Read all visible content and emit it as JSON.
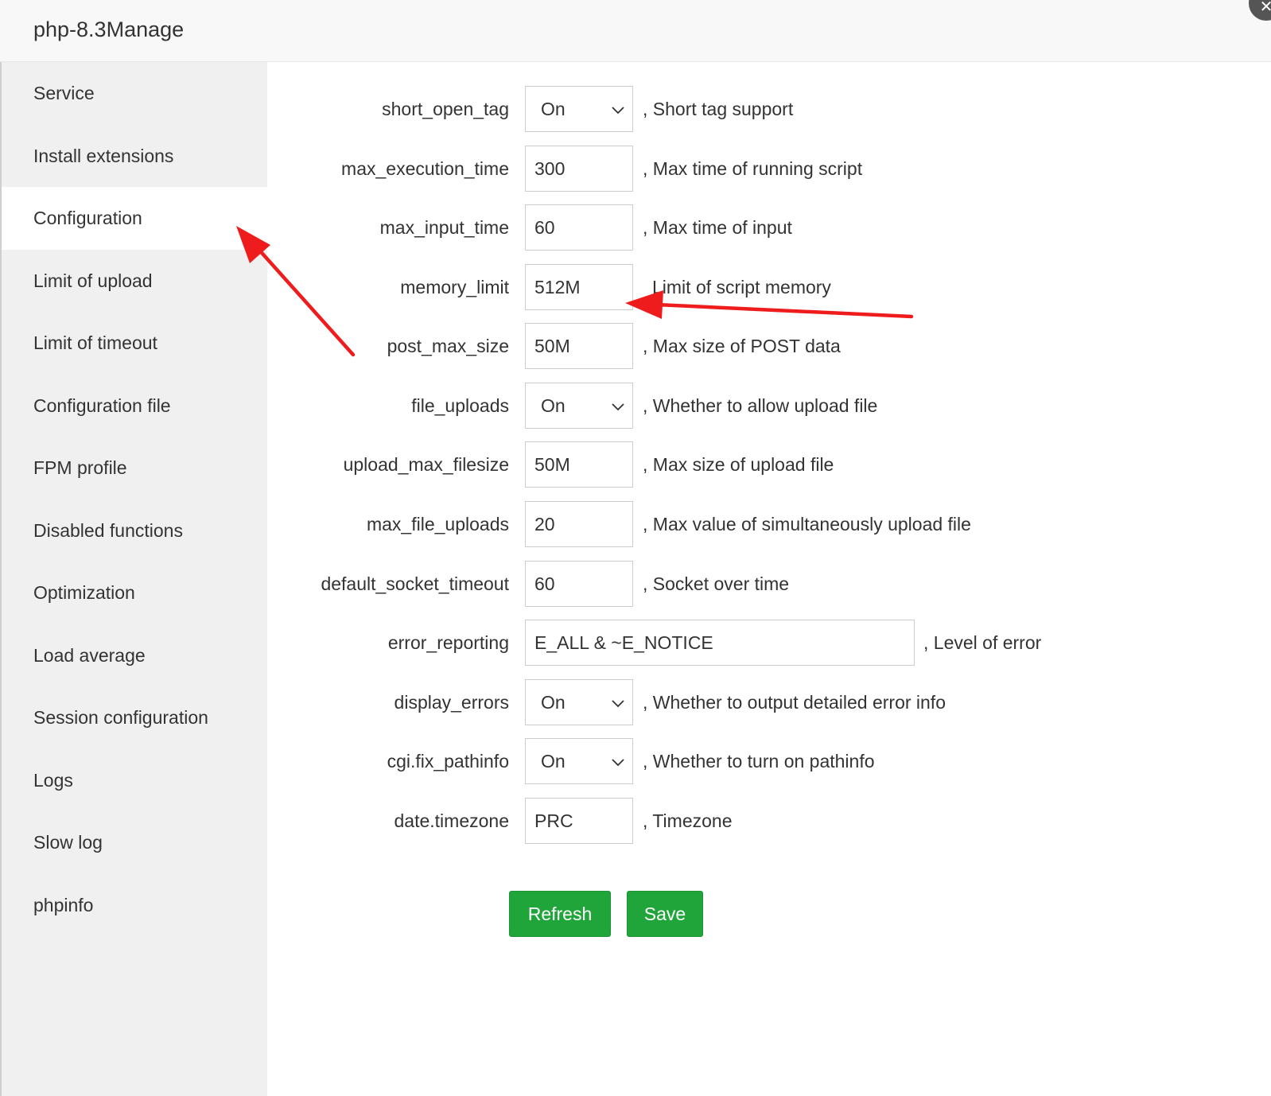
{
  "window": {
    "title": "php-8.3Manage",
    "close_icon": "close-icon"
  },
  "sidebar": {
    "items": [
      {
        "label": "Service"
      },
      {
        "label": "Install extensions"
      },
      {
        "label": "Configuration",
        "active": true
      },
      {
        "label": "Limit of upload"
      },
      {
        "label": "Limit of timeout"
      },
      {
        "label": "Configuration file"
      },
      {
        "label": "FPM profile"
      },
      {
        "label": "Disabled functions"
      },
      {
        "label": "Optimization"
      },
      {
        "label": "Load average"
      },
      {
        "label": "Session configuration"
      },
      {
        "label": "Logs"
      },
      {
        "label": "Slow log"
      },
      {
        "label": "phpinfo"
      }
    ]
  },
  "config": {
    "rows": [
      {
        "key": "short_open_tag",
        "type": "select",
        "value": "On",
        "desc": ", Short tag support"
      },
      {
        "key": "max_execution_time",
        "type": "input",
        "value": "300",
        "desc": ", Max time of running script"
      },
      {
        "key": "max_input_time",
        "type": "input",
        "value": "60",
        "desc": ", Max time of input"
      },
      {
        "key": "memory_limit",
        "type": "input",
        "value": "512M",
        "desc": "Limit of script memory"
      },
      {
        "key": "post_max_size",
        "type": "input",
        "value": "50M",
        "desc": ", Max size of POST data"
      },
      {
        "key": "file_uploads",
        "type": "select",
        "value": "On",
        "desc": ", Whether to allow upload file"
      },
      {
        "key": "upload_max_filesize",
        "type": "input",
        "value": "50M",
        "desc": ", Max size of upload file"
      },
      {
        "key": "max_file_uploads",
        "type": "input",
        "value": "20",
        "desc": ", Max value of simultaneously upload file"
      },
      {
        "key": "default_socket_timeout",
        "type": "input",
        "value": "60",
        "desc": ", Socket over time"
      },
      {
        "key": "error_reporting",
        "type": "input-wide",
        "value": "E_ALL & ~E_NOTICE",
        "desc": ", Level of error"
      },
      {
        "key": "display_errors",
        "type": "select",
        "value": "On",
        "desc": ", Whether to output detailed error info"
      },
      {
        "key": "cgi.fix_pathinfo",
        "type": "select",
        "value": "On",
        "desc": ", Whether to turn on pathinfo"
      },
      {
        "key": "date.timezone",
        "type": "input",
        "value": "PRC",
        "desc": ", Timezone"
      }
    ]
  },
  "actions": {
    "refresh_label": "Refresh",
    "save_label": "Save"
  },
  "annotations": {
    "arrow_color": "#ee1c1c"
  },
  "colors": {
    "primary_button": "#20a53a",
    "sidebar_bg": "#f0f0f0",
    "titlebar_bg": "#f8f8f8"
  }
}
